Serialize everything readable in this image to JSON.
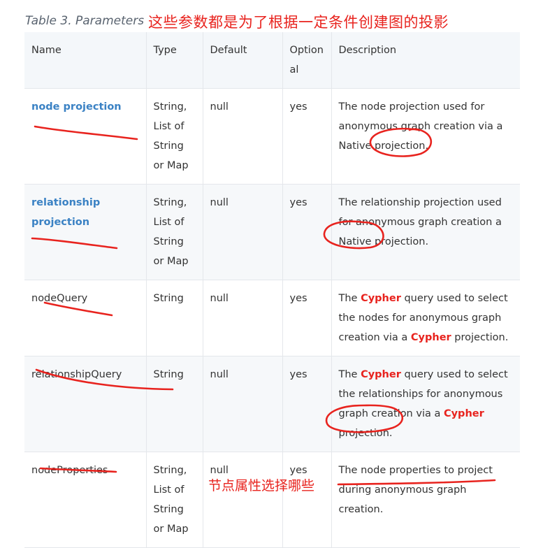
{
  "caption": "Table 3. Parameters",
  "annotation_top": "这些参数都是为了根据一定条件创建图的投影",
  "annotation_bottom": "节点属性选择哪些",
  "headers": {
    "name": "Name",
    "type": "Type",
    "default": "Default",
    "optional": "Optional",
    "description": "Description"
  },
  "rows": [
    {
      "name": "node projection",
      "type": "String, List of String or Map",
      "default": "null",
      "optional": "yes",
      "description": [
        {
          "text": "The node projection used for anonymous graph creation via a Native projection.",
          "kw": false
        }
      ]
    },
    {
      "name": "relationship projection",
      "type": "String, List of String or Map",
      "default": "null",
      "optional": "yes",
      "description": [
        {
          "text": "The relationship projection used for anonymous graph creation a Native projection.",
          "kw": false
        }
      ]
    },
    {
      "name": "nodeQuery",
      "type": "String",
      "default": "null",
      "optional": "yes",
      "description": [
        {
          "text": "The ",
          "kw": false
        },
        {
          "text": "Cypher",
          "kw": true
        },
        {
          "text": " query used to select the nodes for anonymous graph creation via a ",
          "kw": false
        },
        {
          "text": "Cypher",
          "kw": true
        },
        {
          "text": " projection.",
          "kw": false
        }
      ]
    },
    {
      "name": "relationshipQuery",
      "type": "String",
      "default": "null",
      "optional": "yes",
      "description": [
        {
          "text": "The ",
          "kw": false
        },
        {
          "text": "Cypher",
          "kw": true
        },
        {
          "text": " query used to select the relationships for anonymous graph creation via a ",
          "kw": false
        },
        {
          "text": "Cypher",
          "kw": true
        },
        {
          "text": " projection.",
          "kw": false
        }
      ]
    },
    {
      "name": "nodeProperties",
      "type": "String, List of String or Map",
      "default": "null",
      "optional": "yes",
      "description": [
        {
          "text": "The node properties to project during anonymous graph creation.",
          "kw": false
        }
      ]
    }
  ],
  "colors": {
    "link": "#3b82c4",
    "annotation_red": "#e8231e",
    "header_bg": "#f4f7fa"
  }
}
